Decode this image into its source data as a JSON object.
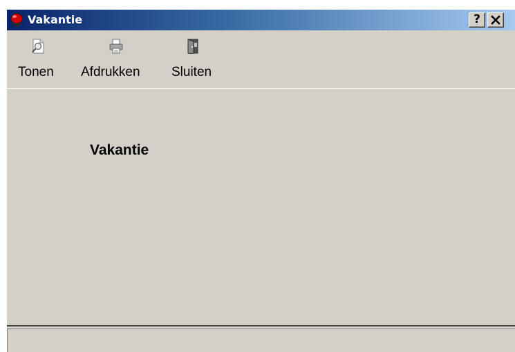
{
  "window": {
    "title": "Vakantie",
    "title_icon": "red-app-icon",
    "help_label": "?",
    "close_label": "✕"
  },
  "toolbar": {
    "items": [
      {
        "label": "Tonen",
        "icon": "preview-icon"
      },
      {
        "label": "Afdrukken",
        "icon": "printer-icon"
      },
      {
        "label": "Sluiten",
        "icon": "door-exit-icon"
      }
    ]
  },
  "content": {
    "heading": "Vakantie"
  },
  "colors": {
    "titlebar_start": "#0a246a",
    "titlebar_end": "#a6caf0",
    "window_bg": "#d4d0c8",
    "accent_red": "#d40000"
  }
}
